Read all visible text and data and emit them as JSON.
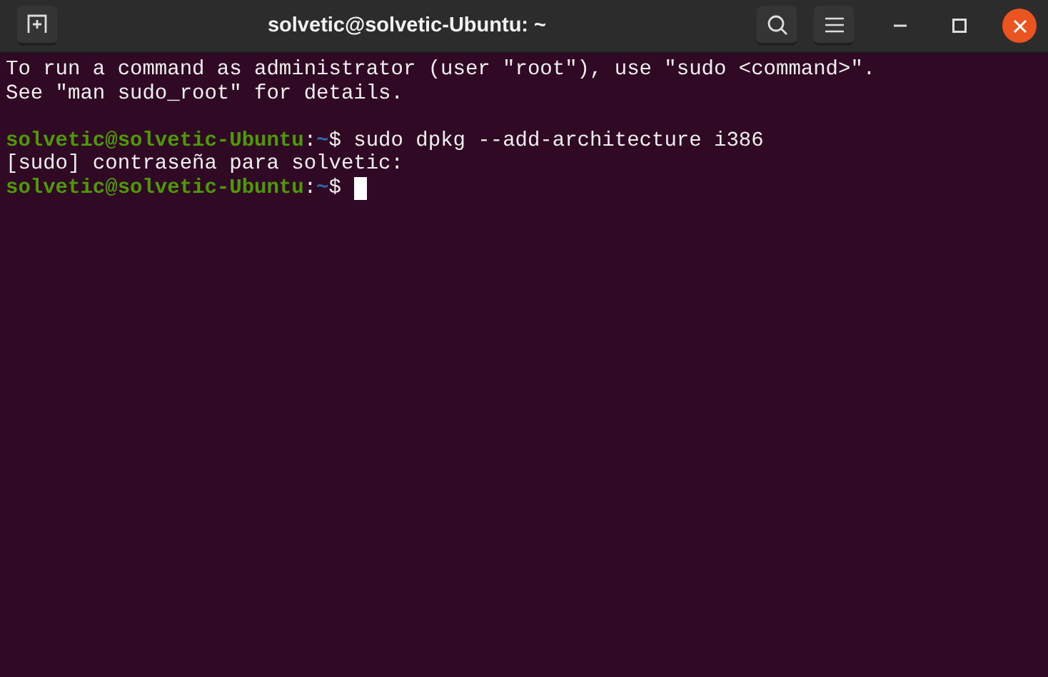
{
  "window": {
    "title": "solvetic@solvetic-Ubuntu: ~"
  },
  "terminal": {
    "blocks": [
      [
        {
          "segments": [
            {
              "kind": "plain",
              "text": "To run a command as administrator (user \"root\"), use \"sudo <command>\"."
            }
          ]
        },
        {
          "segments": [
            {
              "kind": "plain",
              "text": "See \"man sudo_root\" for details."
            }
          ]
        }
      ],
      [
        {
          "segments": [
            {
              "kind": "user",
              "text": "solvetic@solvetic-Ubuntu"
            },
            {
              "kind": "plain",
              "text": ":"
            },
            {
              "kind": "path",
              "text": "~"
            },
            {
              "kind": "plain",
              "text": "$ sudo dpkg --add-architecture i386"
            }
          ]
        },
        {
          "segments": [
            {
              "kind": "plain",
              "text": "[sudo] contraseña para solvetic:"
            }
          ]
        },
        {
          "segments": [
            {
              "kind": "user",
              "text": "solvetic@solvetic-Ubuntu"
            },
            {
              "kind": "plain",
              "text": ":"
            },
            {
              "kind": "path",
              "text": "~"
            },
            {
              "kind": "plain",
              "text": "$"
            }
          ],
          "cursor": true
        }
      ]
    ]
  }
}
